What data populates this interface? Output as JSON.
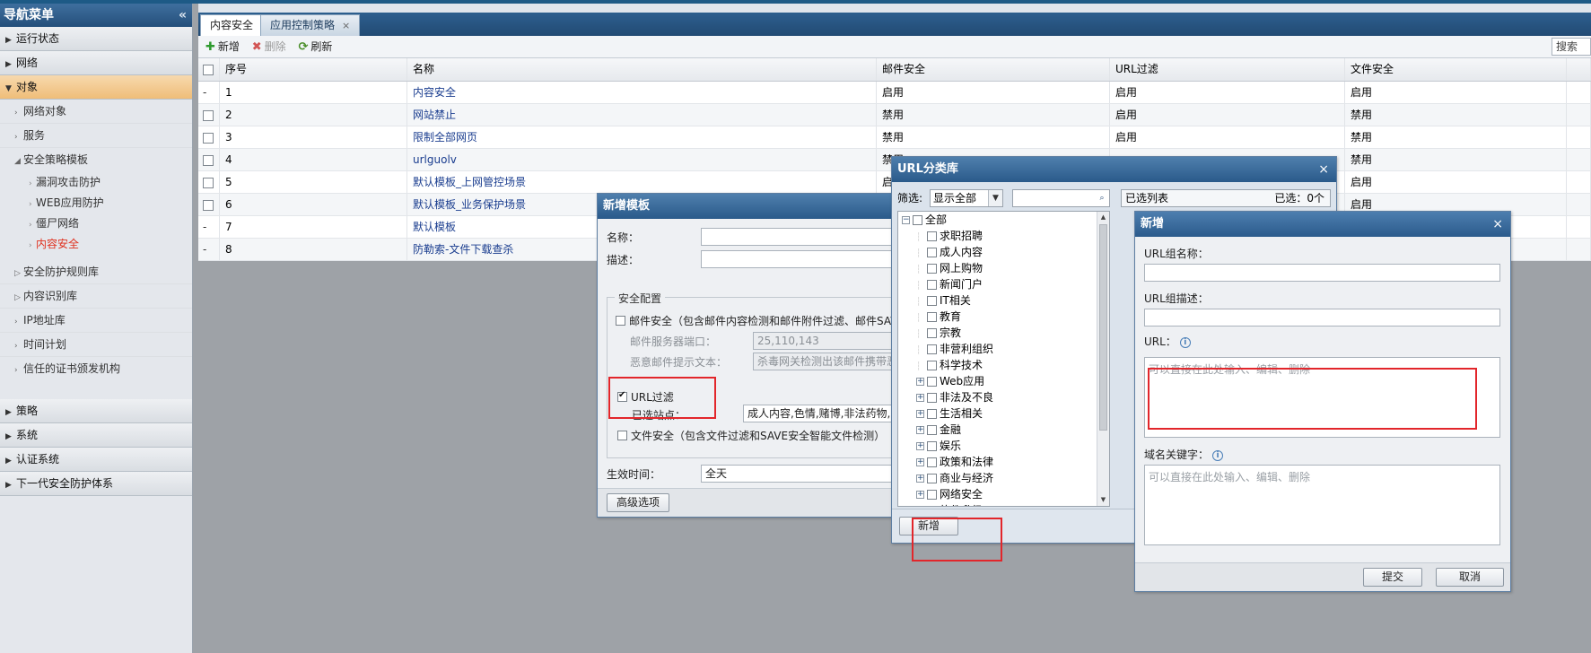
{
  "sidebar": {
    "title": "导航菜单",
    "collapse_glyph": "«",
    "top_items": [
      {
        "label": "运行状态"
      },
      {
        "label": "网络"
      },
      {
        "label": "对象"
      }
    ],
    "object_children": [
      {
        "label": "网络对象"
      },
      {
        "label": "服务"
      },
      {
        "label": "安全策略模板"
      }
    ],
    "template_children": [
      {
        "label": "漏洞攻击防护"
      },
      {
        "label": "WEB应用防护"
      },
      {
        "label": "僵尸网络"
      },
      {
        "label": "内容安全"
      }
    ],
    "object_children_more": [
      {
        "label": "安全防护规则库"
      },
      {
        "label": "内容识别库"
      },
      {
        "label": "IP地址库"
      },
      {
        "label": "时间计划"
      },
      {
        "label": "信任的证书颁发机构"
      }
    ],
    "bottom_items": [
      {
        "label": "策略"
      },
      {
        "label": "系统"
      },
      {
        "label": "认证系统"
      },
      {
        "label": "下一代安全防护体系"
      }
    ]
  },
  "tabs": [
    {
      "label": "内容安全"
    },
    {
      "label": "应用控制策略",
      "close": "×"
    }
  ],
  "toolbar": {
    "add": "新增",
    "delete": "删除",
    "refresh": "刷新",
    "search": "搜索"
  },
  "grid": {
    "columns": [
      "序号",
      "名称",
      "邮件安全",
      "URL过滤",
      "文件安全"
    ],
    "rows": [
      {
        "mark": "-",
        "no": "1",
        "name": "内容安全",
        "mail": "启用",
        "url": "启用",
        "file": "启用"
      },
      {
        "mark": "",
        "no": "2",
        "name": "网站禁止",
        "mail": "禁用",
        "url": "启用",
        "file": "禁用"
      },
      {
        "mark": "",
        "no": "3",
        "name": "限制全部网页",
        "mail": "禁用",
        "url": "启用",
        "file": "禁用"
      },
      {
        "mark": "",
        "no": "4",
        "name": "urlguolv",
        "mail": "禁用",
        "url": "",
        "file": "禁用"
      },
      {
        "mark": "",
        "no": "5",
        "name": "默认模板_上网管控场景",
        "mail": "启用",
        "url": "",
        "file": "启用"
      },
      {
        "mark": "",
        "no": "6",
        "name": "默认模板_业务保护场景",
        "mail": "",
        "url": "",
        "file": "启用"
      },
      {
        "mark": "-",
        "no": "7",
        "name": "默认模板",
        "mail": "",
        "url": "",
        "file": ""
      },
      {
        "mark": "-",
        "no": "8",
        "name": "防勒索-文件下载查杀",
        "mail": "",
        "url": "",
        "file": ""
      }
    ]
  },
  "template_dialog": {
    "title": "新增模板",
    "name_label": "名称：",
    "desc_label": "描述：",
    "legend": "安全配置",
    "mail_label": "邮件安全（包含邮件内容检测和邮件附件过滤、邮件SAVE",
    "mail_port_label": "邮件服务器端口：",
    "mail_port_value": "25,110,143",
    "mail_text_label": "恶意邮件提示文本：",
    "mail_text_value": "杀毒网关检测出该邮件携带恶",
    "url_filter_label": "URL过滤",
    "selected_sites_label": "已选站点：",
    "selected_sites_value": "成人内容,色情,赌博,非法药物,反",
    "file_label": "文件安全（包含文件过滤和SAVE安全智能文件检测）",
    "effective_label": "生效时间：",
    "effective_value": "全天",
    "advanced_button": "高级选项"
  },
  "category_dialog": {
    "title": "URL分类库",
    "close": "×",
    "filter_label": "筛选:",
    "filter_value": "显示全部",
    "selected_list_label": "已选列表",
    "selected_count": "已选：0个",
    "tree": [
      {
        "label": "全部",
        "toggle": "−",
        "level": 0
      },
      {
        "label": "求职招聘",
        "level": 1
      },
      {
        "label": "成人内容",
        "level": 1
      },
      {
        "label": "网上购物",
        "level": 1
      },
      {
        "label": "新闻门户",
        "level": 1
      },
      {
        "label": "IT相关",
        "level": 1
      },
      {
        "label": "教育",
        "level": 1
      },
      {
        "label": "宗教",
        "level": 1
      },
      {
        "label": "非营利组织",
        "level": 1
      },
      {
        "label": "科学技术",
        "level": 1
      },
      {
        "label": "Web应用",
        "toggle": "+",
        "level": 1
      },
      {
        "label": "非法及不良",
        "toggle": "+",
        "level": 1
      },
      {
        "label": "生活相关",
        "toggle": "+",
        "level": 1
      },
      {
        "label": "金融",
        "toggle": "+",
        "level": 1
      },
      {
        "label": "娱乐",
        "toggle": "+",
        "level": 1
      },
      {
        "label": "政策和法律",
        "toggle": "+",
        "level": 1
      },
      {
        "label": "商业与经济",
        "toggle": "+",
        "level": 1
      },
      {
        "label": "网络安全",
        "toggle": "+",
        "level": 1
      },
      {
        "label": "软件升级",
        "toggle": "+",
        "level": 1
      }
    ],
    "new_button": "新增"
  },
  "new_dialog": {
    "title": "新增",
    "close": "×",
    "group_name_label": "URL组名称：",
    "group_desc_label": "URL组描述：",
    "url_label": "URL：",
    "url_placeholder": "可以直接在此处输入、编辑、删除",
    "keyword_label": "域名关键字：",
    "keyword_placeholder": "可以直接在此处输入、编辑、删除",
    "submit": "提交",
    "cancel": "取消",
    "info_glyph": "i"
  }
}
